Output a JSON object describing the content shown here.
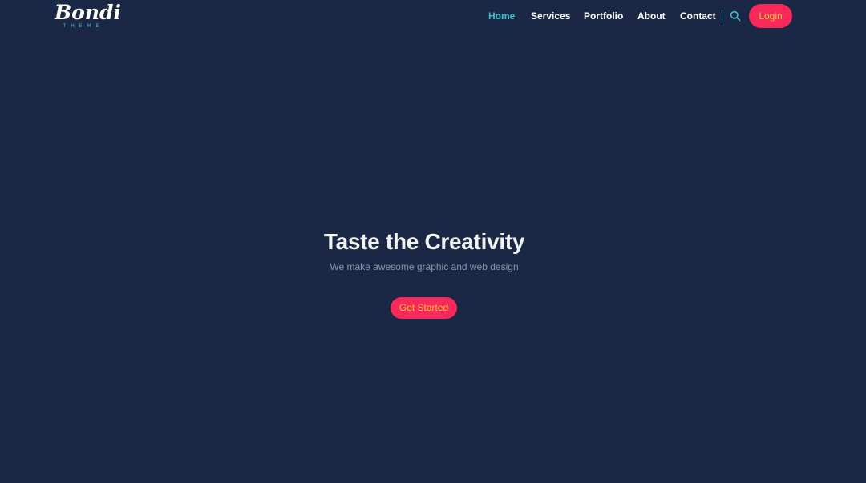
{
  "brand": {
    "logo_script": "Bondi",
    "logo_sub": "THEME"
  },
  "nav": {
    "items": [
      {
        "label": "Home",
        "active": true
      },
      {
        "label": "Services",
        "active": false
      },
      {
        "label": "Portfolio",
        "active": false
      },
      {
        "label": "About",
        "active": false
      },
      {
        "label": "Contact",
        "active": false
      }
    ],
    "search_icon": "search-icon",
    "login_label": "Login"
  },
  "hero": {
    "title": "Taste the Creativity",
    "subtitle": "We make awesome graphic and web design",
    "cta_label": "Get Started"
  },
  "colors": {
    "background": "#1b2845",
    "accent": "#37c2d3",
    "button": "#f7295a",
    "button_text": "#ffc83d"
  }
}
